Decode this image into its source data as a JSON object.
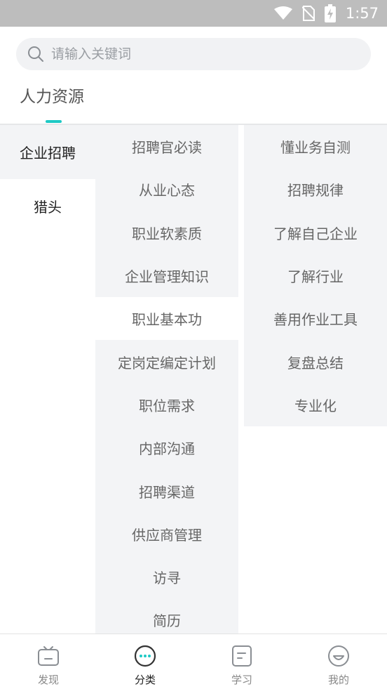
{
  "status_bar": {
    "time": "1:57"
  },
  "search": {
    "placeholder": "请输入关键词",
    "value": ""
  },
  "top_tabs": [
    {
      "label": "人力资源"
    }
  ],
  "col1": [
    {
      "label": "企业招聘",
      "active": true
    },
    {
      "label": "猎头",
      "active": false
    }
  ],
  "col2": [
    {
      "label": "招聘官必读"
    },
    {
      "label": "从业心态"
    },
    {
      "label": "职业软素质"
    },
    {
      "label": "企业管理知识"
    },
    {
      "label": "职业基本功",
      "active": true
    },
    {
      "label": "定岗定编定计划"
    },
    {
      "label": "职位需求"
    },
    {
      "label": "内部沟通"
    },
    {
      "label": "招聘渠道"
    },
    {
      "label": "供应商管理"
    },
    {
      "label": "访寻"
    },
    {
      "label": "简历"
    }
  ],
  "col3": [
    {
      "label": "懂业务自测"
    },
    {
      "label": "招聘规律"
    },
    {
      "label": "了解自己企业"
    },
    {
      "label": "了解行业"
    },
    {
      "label": "善用作业工具"
    },
    {
      "label": "复盘总结"
    },
    {
      "label": "专业化"
    }
  ],
  "bottom_nav": [
    {
      "label": "发现",
      "icon": "tv-icon"
    },
    {
      "label": "分类",
      "icon": "more-circle-icon",
      "active": true
    },
    {
      "label": "学习",
      "icon": "note-icon"
    },
    {
      "label": "我的",
      "icon": "smile-icon"
    }
  ],
  "colors": {
    "accent": "#1ec9c5",
    "panel_bg": "#f3f4f6",
    "status_bar": "#bdbdbd"
  }
}
